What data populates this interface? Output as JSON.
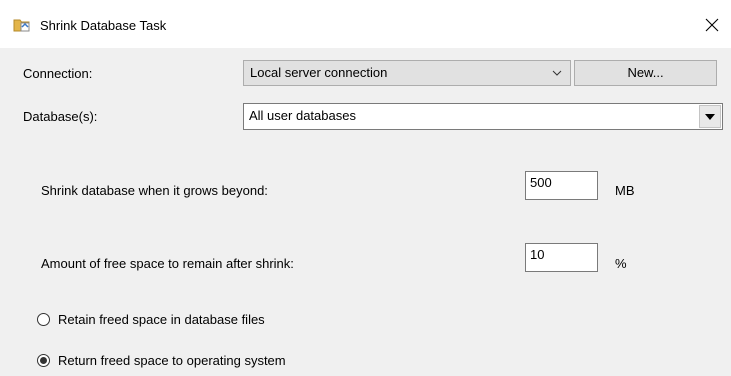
{
  "window": {
    "title": "Shrink Database Task",
    "close_glyph": "✕"
  },
  "connection": {
    "label": "Connection:",
    "selected": "Local server connection",
    "new_button": "New..."
  },
  "databases": {
    "label": "Database(s):",
    "selected": "All user databases"
  },
  "shrink_threshold": {
    "label": "Shrink database when it grows beyond:",
    "value": "500",
    "unit": "MB"
  },
  "free_space": {
    "label": "Amount of free space to remain after shrink:",
    "value": "10",
    "unit": "%"
  },
  "options": [
    {
      "label": "Retain freed space in database files",
      "selected": false
    },
    {
      "label": "Return freed space to operating system",
      "selected": true
    }
  ],
  "icons": {
    "app": "shrink-database-task-icon",
    "close": "close-icon",
    "connection_dropdown": "chevron-down-icon",
    "database_dropdown": "dropdown-arrow-icon"
  }
}
